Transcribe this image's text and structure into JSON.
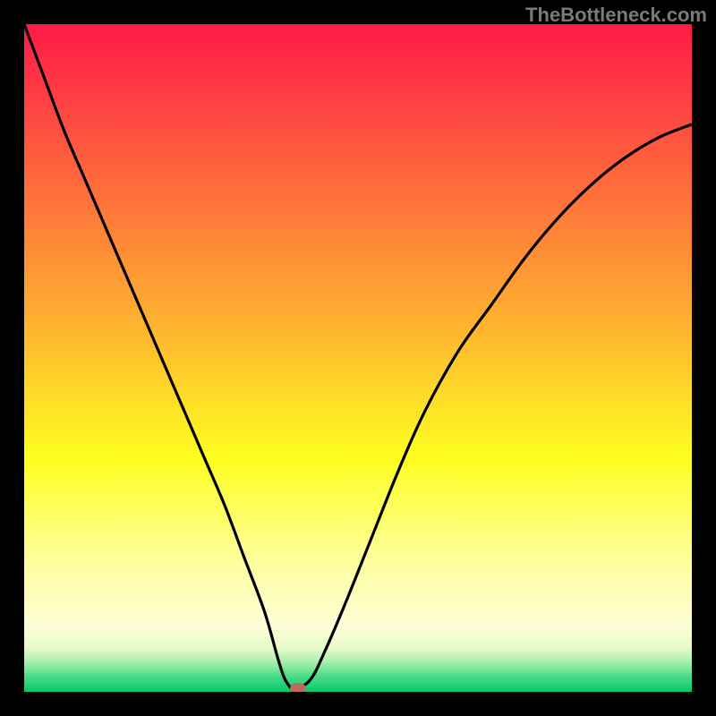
{
  "watermark": "TheBottleneck.com",
  "chart_data": {
    "type": "line",
    "title": "",
    "xlabel": "",
    "ylabel": "",
    "xlim": [
      0,
      100
    ],
    "ylim": [
      0,
      100
    ],
    "x": [
      0,
      3,
      6,
      9,
      12,
      15,
      18,
      21,
      24,
      27,
      30,
      33,
      36,
      38,
      39,
      40,
      41,
      43,
      45,
      48,
      52,
      56,
      60,
      65,
      70,
      75,
      80,
      85,
      90,
      95,
      100
    ],
    "values": [
      100,
      92,
      84,
      77,
      70,
      63,
      56,
      49,
      42,
      35,
      28,
      20,
      12,
      5,
      2,
      0.5,
      0.5,
      2,
      6,
      13,
      23,
      33,
      42,
      51,
      58,
      65,
      71,
      76,
      80,
      83,
      85
    ],
    "marker": {
      "x": 41,
      "y": 0.5
    },
    "gradient_stops": [
      {
        "pos": 0,
        "color": "#fe1a48"
      },
      {
        "pos": 0.2,
        "color": "#fe5d3e"
      },
      {
        "pos": 0.45,
        "color": "#feb330"
      },
      {
        "pos": 0.65,
        "color": "#fefe20"
      },
      {
        "pos": 0.8,
        "color": "#fefe9a"
      },
      {
        "pos": 0.9,
        "color": "#fefed6"
      },
      {
        "pos": 0.935,
        "color": "#e6fac8"
      },
      {
        "pos": 0.955,
        "color": "#a8efad"
      },
      {
        "pos": 0.975,
        "color": "#52dd8b"
      },
      {
        "pos": 1.0,
        "color": "#02c868"
      }
    ]
  }
}
